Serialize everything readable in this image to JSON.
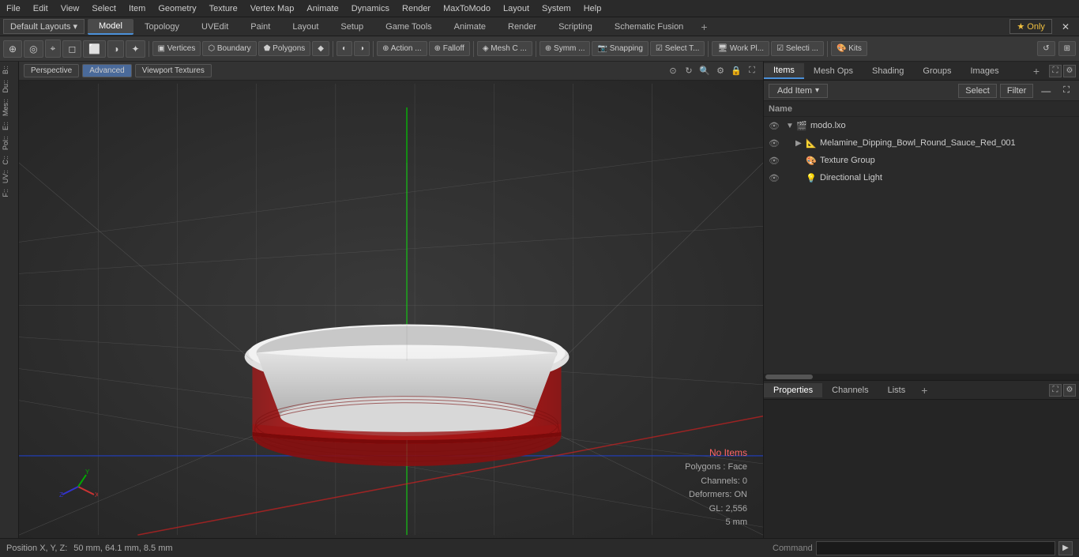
{
  "menu": {
    "items": [
      "File",
      "Edit",
      "View",
      "Select",
      "Item",
      "Geometry",
      "Texture",
      "Vertex Map",
      "Animate",
      "Dynamics",
      "Render",
      "MaxToModo",
      "Layout",
      "System",
      "Help"
    ]
  },
  "layout": {
    "dropdown": "Default Layouts ▾",
    "tabs": [
      "Model",
      "Topology",
      "UVEdit",
      "Paint",
      "Layout",
      "Setup",
      "Game Tools",
      "Animate",
      "Render",
      "Scripting",
      "Schematic Fusion"
    ],
    "active_tab": "Model",
    "add_tab": "+",
    "star_label": "★ Only"
  },
  "toolbar": {
    "buttons": [
      {
        "label": "⊕",
        "type": "icon"
      },
      {
        "label": "◎",
        "type": "icon"
      },
      {
        "label": "⌖",
        "type": "icon"
      },
      {
        "label": "◻",
        "type": "icon"
      },
      {
        "label": "⬜",
        "type": "icon"
      },
      {
        "label": "◑",
        "type": "icon"
      },
      {
        "label": "❋",
        "type": "icon"
      },
      {
        "label": "SEP"
      },
      {
        "label": "▣ Vertices",
        "active": false
      },
      {
        "label": "⬡ Boundary",
        "active": false
      },
      {
        "label": "⬟ Polygons",
        "active": false
      },
      {
        "label": "◆",
        "active": false
      },
      {
        "label": "SEP"
      },
      {
        "label": "◐",
        "active": false
      },
      {
        "label": "◑",
        "active": false
      },
      {
        "label": "SEP"
      },
      {
        "label": "⊕ Action ...",
        "active": false
      },
      {
        "label": "⊕ Falloff",
        "active": false
      },
      {
        "label": "SEP"
      },
      {
        "label": "◈ Mesh C ...",
        "active": false
      },
      {
        "label": "SEP"
      },
      {
        "label": "⊕ Symm ...",
        "active": false
      },
      {
        "label": "📷 Snapping",
        "active": false
      },
      {
        "label": "☑ Select T...",
        "active": false
      },
      {
        "label": "SEP"
      },
      {
        "label": "🖥 Work Pl...",
        "active": false
      },
      {
        "label": "☑ Selecti ...",
        "active": false
      },
      {
        "label": "SEP"
      },
      {
        "label": "🎨 Kits",
        "active": false
      }
    ],
    "right_icons": [
      "↺",
      "⊞"
    ]
  },
  "viewport": {
    "header": {
      "perspective_label": "Perspective",
      "advanced_label": "Advanced",
      "viewport_textures_label": "Viewport Textures"
    },
    "status": {
      "no_items": "No Items",
      "polygons": "Polygons : Face",
      "channels": "Channels: 0",
      "deformers": "Deformers: ON",
      "gl": "GL: 2,556",
      "count": "5 mm"
    }
  },
  "left_sidebar": {
    "items": [
      "B::",
      "Du::",
      "Mes::",
      "E::",
      "Pol::",
      "C::",
      "UV::",
      "F::"
    ]
  },
  "items_panel": {
    "tabs": [
      "Items",
      "Mesh Ops",
      "Shading",
      "Groups",
      "Images"
    ],
    "add_item_label": "Add Item",
    "select_label": "Select",
    "filter_label": "Filter",
    "col_header": "Name",
    "tree": [
      {
        "level": 0,
        "icon": "🎬",
        "label": "modo.lxo",
        "has_arrow": true,
        "arrow_open": true,
        "eye": true
      },
      {
        "level": 1,
        "icon": "📐",
        "label": "Melamine_Dipping_Bowl_Round_Sauce_Red_001",
        "has_arrow": true,
        "arrow_open": false,
        "eye": true
      },
      {
        "level": 1,
        "icon": "🎨",
        "label": "Texture Group",
        "has_arrow": false,
        "arrow_open": false,
        "eye": true
      },
      {
        "level": 1,
        "icon": "💡",
        "label": "Directional Light",
        "has_arrow": false,
        "arrow_open": false,
        "eye": true
      }
    ]
  },
  "properties_panel": {
    "tabs": [
      "Properties",
      "Channels",
      "Lists"
    ],
    "add_label": "+"
  },
  "status_bar": {
    "position_label": "Position X, Y, Z:",
    "position_value": "50 mm, 64.1 mm, 8.5 mm",
    "command_label": "Command",
    "command_placeholder": ""
  }
}
